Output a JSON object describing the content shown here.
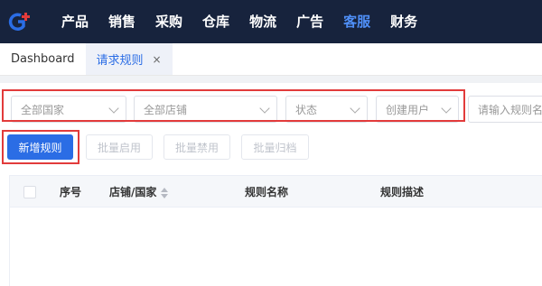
{
  "nav": {
    "items": [
      {
        "label": "产品"
      },
      {
        "label": "销售"
      },
      {
        "label": "采购"
      },
      {
        "label": "仓库"
      },
      {
        "label": "物流"
      },
      {
        "label": "广告"
      },
      {
        "label": "客服"
      },
      {
        "label": "财务"
      }
    ],
    "active": "客服"
  },
  "tabs": [
    {
      "label": "Dashboard"
    },
    {
      "label": "请求规则",
      "close": "×"
    }
  ],
  "filters": {
    "country": "全部国家",
    "store": "全部店铺",
    "status": "状态",
    "creator": "创建用户",
    "search_placeholder": "请输入规则名称"
  },
  "actions": {
    "add": "新增规则",
    "batch_enable": "批量启用",
    "batch_disable": "批量禁用",
    "batch_archive": "批量归档"
  },
  "table": {
    "columns": [
      "序号",
      "店铺/国家",
      "规则名称",
      "规则描述"
    ]
  },
  "colors": {
    "nav_bg": "#17233d",
    "accent": "#2b6de5",
    "highlight": "#e23b3b"
  }
}
